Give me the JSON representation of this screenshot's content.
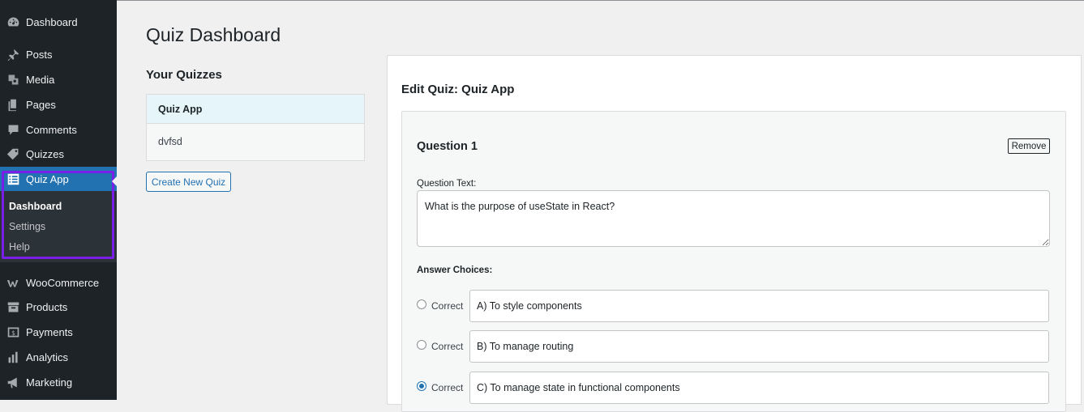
{
  "sidebar": {
    "items": [
      {
        "label": "Dashboard",
        "icon": "dashboard-icon"
      },
      {
        "label": "Posts",
        "icon": "pin-icon"
      },
      {
        "label": "Media",
        "icon": "media-icon"
      },
      {
        "label": "Pages",
        "icon": "pages-icon"
      },
      {
        "label": "Comments",
        "icon": "comment-icon"
      },
      {
        "label": "Quizzes",
        "icon": "tag-icon"
      },
      {
        "label": "Quiz App",
        "icon": "list-icon"
      },
      {
        "label": "WooCommerce",
        "icon": "woo-icon"
      },
      {
        "label": "Products",
        "icon": "archive-icon"
      },
      {
        "label": "Payments",
        "icon": "dollar-icon"
      },
      {
        "label": "Analytics",
        "icon": "bar-chart-icon"
      },
      {
        "label": "Marketing",
        "icon": "megaphone-icon"
      }
    ],
    "submenu": [
      "Dashboard",
      "Settings",
      "Help"
    ]
  },
  "page": {
    "title": "Quiz Dashboard",
    "your_quizzes": "Your Quizzes",
    "quizzes": [
      "Quiz App",
      "dvfsd"
    ],
    "create_button": "Create New Quiz"
  },
  "editor": {
    "title": "Edit Quiz: Quiz App",
    "question_title": "Question 1",
    "remove_label": "Remove",
    "question_text_label": "Question Text:",
    "question_text": "What is the purpose of useState in React?",
    "answer_choices_label": "Answer Choices:",
    "correct_label": "Correct",
    "answers": [
      {
        "text": "A) To style components",
        "correct": false
      },
      {
        "text": "B) To manage routing",
        "correct": false
      },
      {
        "text": "C) To manage state in functional components",
        "correct": true
      }
    ]
  },
  "colors": {
    "sidebar_bg": "#1d2327",
    "active_bg": "#2271b1",
    "highlight": "#7a1fe8",
    "selected_quiz_bg": "#e5f5fa"
  }
}
